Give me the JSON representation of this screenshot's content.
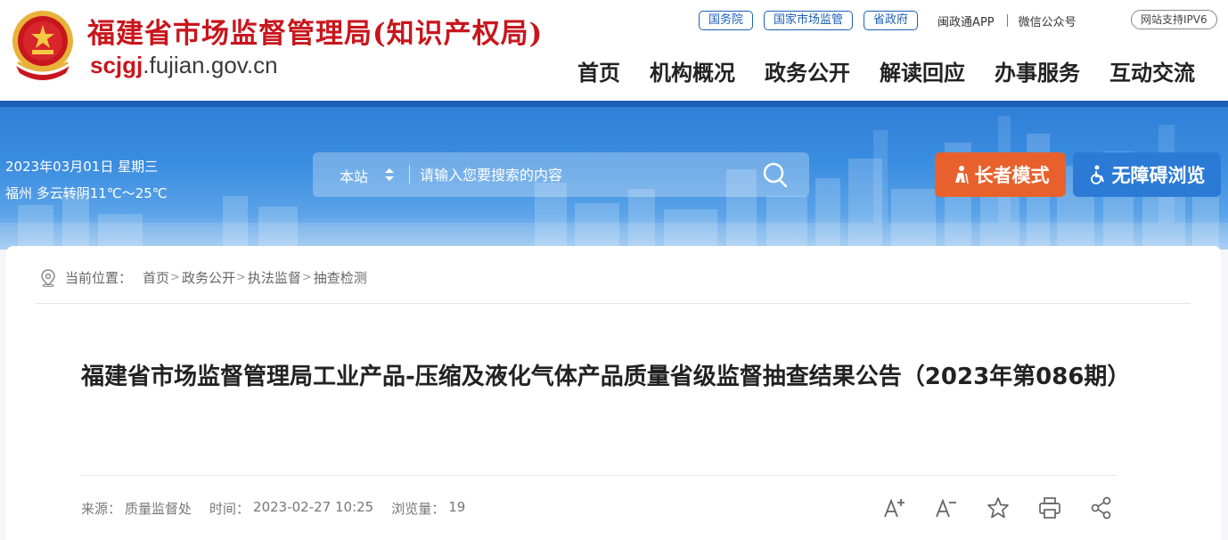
{
  "header": {
    "site_title": "福建省市场监督管理局(知识产权局)",
    "domain_highlight": "scjgj",
    "domain_rest": ".fujian.gov.cn",
    "top_links": [
      "国务院",
      "国家市场监管",
      "省政府"
    ],
    "app_link": "闽政通APP",
    "wechat_link": "微信公众号",
    "ipv6": "网站支持IPV6",
    "nav": [
      "首页",
      "机构概况",
      "政务公开",
      "解读回应",
      "办事服务",
      "互动交流"
    ]
  },
  "banner": {
    "date": "2023年03月01日 星期三",
    "weather": "福州 多云转阴11℃～25℃",
    "search_scope": "本站",
    "search_placeholder": "请输入您要搜索的内容",
    "elder_mode": "长者模式",
    "accessible": "无障碍浏览"
  },
  "breadcrumb": {
    "label": "当前位置：",
    "items": [
      "首页",
      "政务公开",
      "执法监督",
      "抽查检测"
    ]
  },
  "article": {
    "title": "福建省市场监督管理局工业产品-压缩及液化气体产品质量省级监督抽查结果公告（2023年第086期）",
    "source_label": "来源：",
    "source": "质量监督处",
    "time_label": "时间：",
    "time": "2023-02-27 10:25",
    "views_label": "浏览量：",
    "views": "19"
  },
  "tools": [
    "font-increase-icon",
    "font-decrease-icon",
    "favorite-star-icon",
    "print-icon",
    "share-icon"
  ],
  "colors": {
    "brand_red": "#c8161d",
    "brand_blue": "#1d5fb6",
    "elder_orange": "#e8612c"
  }
}
